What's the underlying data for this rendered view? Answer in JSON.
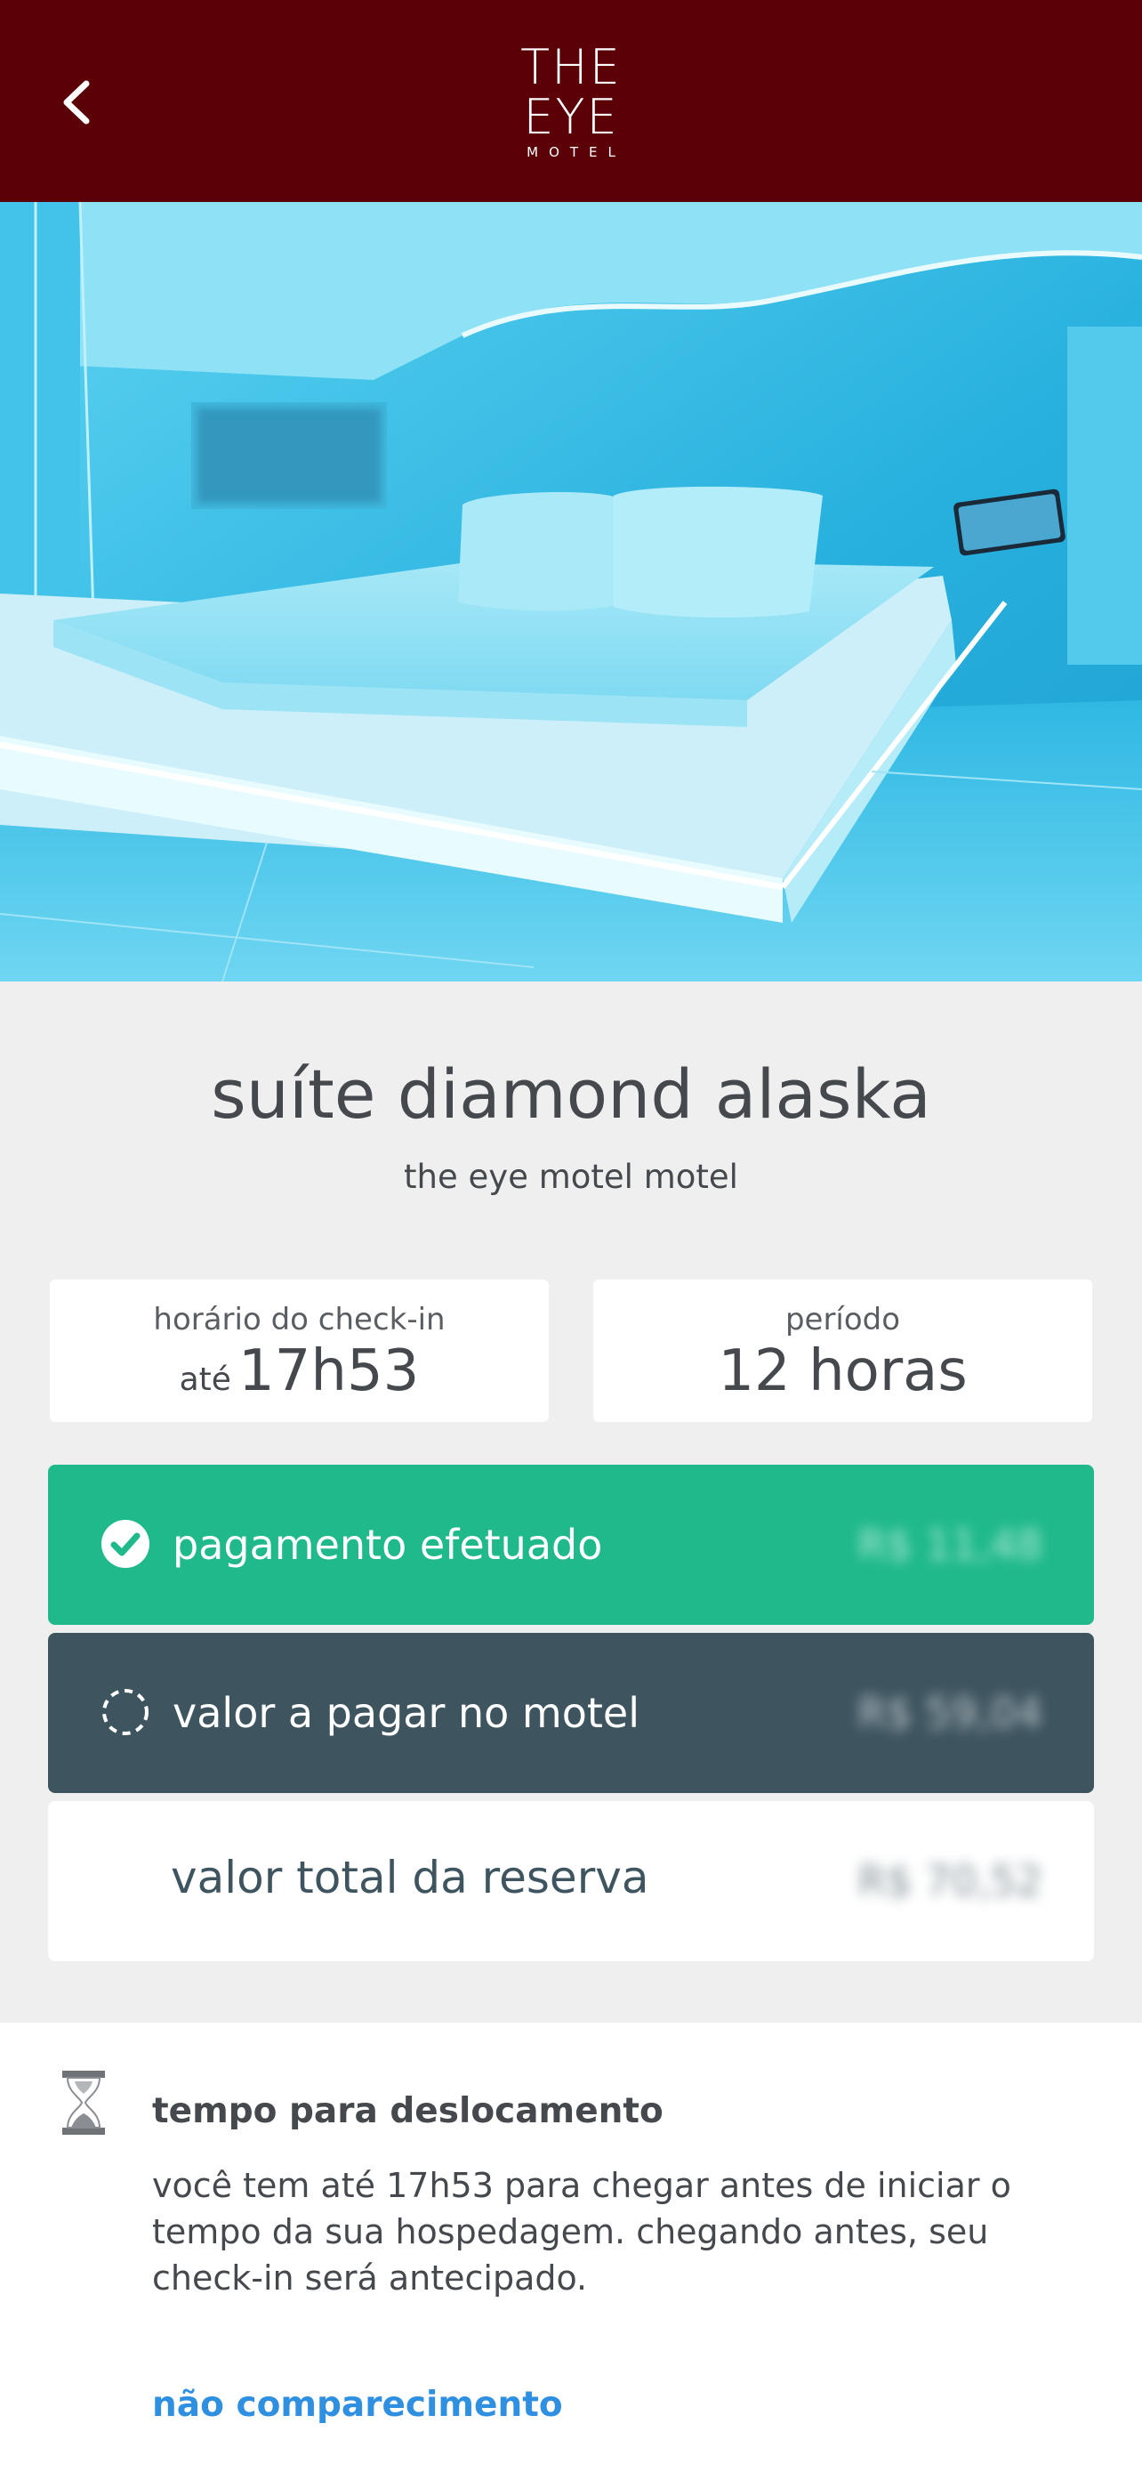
{
  "header": {
    "logo_line1": "THE",
    "logo_line2": "EYE",
    "logo_sub": "MOTEL",
    "background_color": "#5a0006"
  },
  "room": {
    "title": "suíte diamond alaska",
    "motel_name": "the eye motel  motel"
  },
  "checkin": {
    "label": "horário do check-in",
    "prefix": "até",
    "value": "17h53"
  },
  "period": {
    "label": "período",
    "value": "12 horas"
  },
  "payments": {
    "paid_label": "pagamento efetuado",
    "paid_amount": "R$ 11,48",
    "paid_color": "#1fb98b",
    "pending_label": "valor a pagar no motel",
    "pending_amount": "R$ 59,04",
    "pending_color": "#3e5560",
    "total_label": "valor total da reserva",
    "total_amount": "R$ 70,52"
  },
  "travel": {
    "title": "tempo para deslocamento",
    "description": "você tem até 17h53 para chegar antes de iniciar o tempo da sua hospedagem. chegando antes, seu check-in será antecipado."
  },
  "no_show": {
    "link_label": "não comparecimento",
    "link_color": "#2f8fe0"
  },
  "icons": {
    "back": "chevron-left-icon",
    "paid": "check-circle-icon",
    "pending": "dashed-circle-icon",
    "travel": "hourglass-icon"
  }
}
